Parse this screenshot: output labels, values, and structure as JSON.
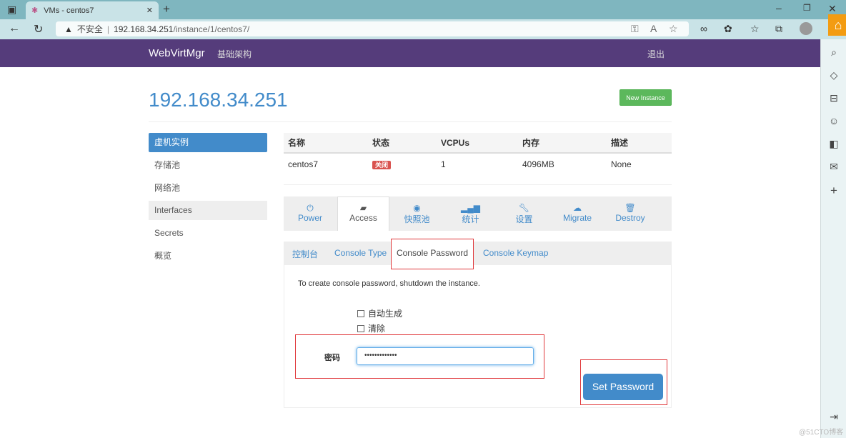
{
  "browser": {
    "tab_title": "VMs - centos7",
    "insecure_label": "不安全",
    "url_host": "192.168.34.251",
    "url_path": "/instance/1/centos7/"
  },
  "navbar": {
    "brand": "WebVirtMgr",
    "infra": "基础架构",
    "logout": "退出",
    "color": "#553c7b"
  },
  "page": {
    "title": "192.168.34.251",
    "new_instance": "New Instance"
  },
  "sidebar": {
    "items": [
      {
        "label": "虚机实例",
        "active": true
      },
      {
        "label": "存储池"
      },
      {
        "label": "网络池"
      },
      {
        "label": "Interfaces"
      },
      {
        "label": "Secrets"
      },
      {
        "label": "概览"
      }
    ]
  },
  "table": {
    "headers": [
      "名称",
      "状态",
      "VCPUs",
      "内存",
      "描述"
    ],
    "row": {
      "name": "centos7",
      "status": "关闭",
      "vcpus": "1",
      "memory": "4096MB",
      "desc": "None"
    }
  },
  "tabs": [
    {
      "label": "Power",
      "icon": "power-icon"
    },
    {
      "label": "Access",
      "icon": "briefcase-icon",
      "active": true
    },
    {
      "label": "快照池",
      "icon": "camera-icon"
    },
    {
      "label": "统计",
      "icon": "signal-icon"
    },
    {
      "label": "设置",
      "icon": "wrench-icon"
    },
    {
      "label": "Migrate",
      "icon": "cloud-icon"
    },
    {
      "label": "Destroy",
      "icon": "trash-icon"
    }
  ],
  "subtabs": [
    {
      "label": "控制台"
    },
    {
      "label": "Console Type"
    },
    {
      "label": "Console Password",
      "active": true
    },
    {
      "label": "Console Keymap"
    }
  ],
  "form": {
    "notice": "To create console password, shutdown the instance.",
    "auto_generate": "自动生成",
    "clear": "清除",
    "password_label": "密码",
    "password_value": "•••••••••••••",
    "submit": "Set Password"
  },
  "watermark": "@51CTO博客"
}
